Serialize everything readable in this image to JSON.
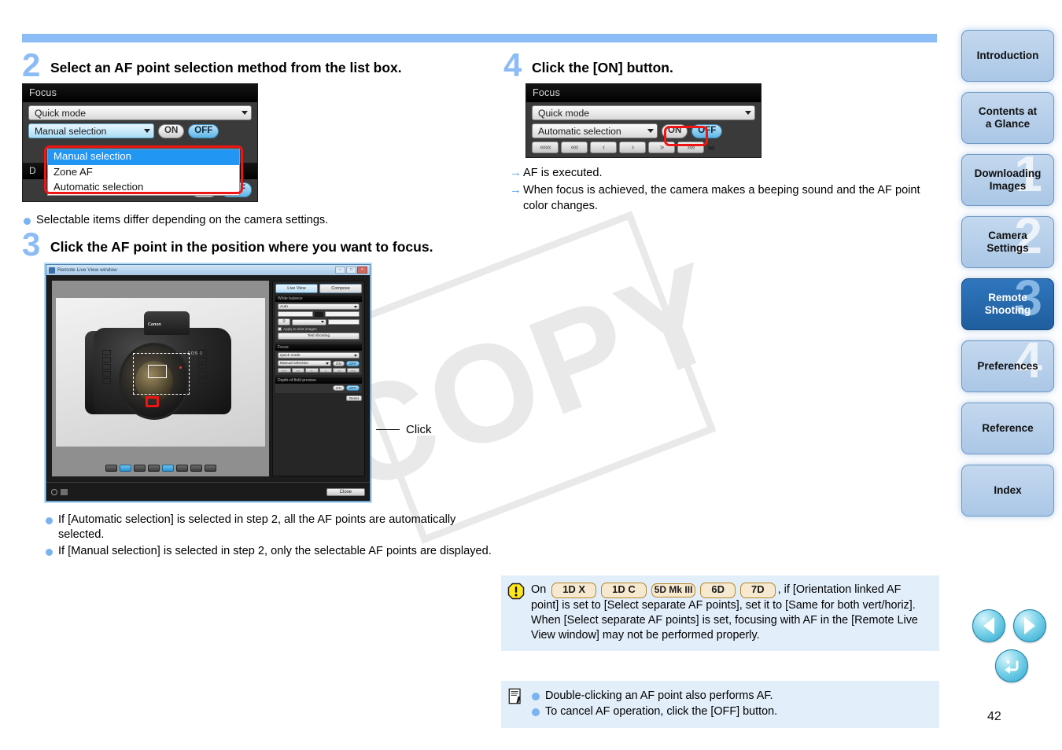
{
  "page": {
    "number": "42"
  },
  "steps": [
    {
      "num": "2",
      "title": "Select an AF point selection method from the list box.",
      "bullets": [
        "Selectable items differ depending on the camera settings."
      ]
    },
    {
      "num": "3",
      "title": "Click the AF point in the position where you want to focus.",
      "bullets": [
        "If [Automatic selection] is selected in step 2, all the AF points are automatically selected.",
        "If [Manual selection] is selected in step 2, only the selectable AF points are displayed."
      ]
    },
    {
      "num": "4",
      "title": "Click the [ON] button.",
      "arrows": [
        "AF is executed.",
        "When focus is achieved, the camera makes a beeping sound and the AF point color changes."
      ]
    }
  ],
  "focus_panel_step2": {
    "title": "Focus",
    "mode_value": "Quick mode",
    "selection_value": "Manual selection",
    "on_label": "ON",
    "off_label": "OFF",
    "dropdown_options": [
      "Manual selection",
      "Zone AF",
      "Automatic selection"
    ],
    "dropdown_selected": "Manual selection",
    "dof_title": "D",
    "dof_on_label": "ON",
    "dof_off_label": "OFF"
  },
  "focus_panel_step4": {
    "title": "Focus",
    "mode_value": "Quick mode",
    "selection_value": "Automatic selection",
    "on_label": "ON",
    "off_label": "OFF",
    "nav_buttons": [
      "«««",
      "««",
      "‹",
      "›",
      "»",
      "»»"
    ],
    "infinity_symbol": "∞"
  },
  "live_view_window": {
    "title": "Remote Live View window",
    "minimize_label": "–",
    "maximize_label": "□",
    "close_label": "×",
    "tabs": [
      "Live View",
      "Compose"
    ],
    "active_tab": "Live View",
    "white_balance": {
      "header": "White balance",
      "value": "Auto",
      "apply_label": "Apply to shot images",
      "test_shooting_label": "Test shooting"
    },
    "focus": {
      "header": "Focus",
      "mode_value": "Quick mode",
      "selection_value": "Manual selection",
      "on_label": "ON",
      "off_label": "OFF"
    },
    "dof": {
      "header": "Depth-of-field preview",
      "on_label": "ON",
      "off_label": "OFF",
      "extra_button": "Reset"
    },
    "camera_brand": "Canon",
    "camera_model": "EOS-1",
    "close_button": "Close"
  },
  "callout": {
    "label": "Click"
  },
  "notice_warning": {
    "icon": "warning-icon",
    "text_before": "On",
    "models": [
      "1D X",
      "1D C",
      "5D Mk III",
      "6D",
      "7D"
    ],
    "text_after": ", if [Orientation linked AF point] is set to [Select separate AF points], set it to [Same for both vert/horiz]. When [Select separate AF points] is set, focusing with AF in the [Remote Live View window] may not be performed properly."
  },
  "notice_note": {
    "icon": "note-icon",
    "items": [
      "Double-clicking an AF point also performs AF.",
      "To cancel AF operation, click the [OFF] button."
    ]
  },
  "sidebar": {
    "items": [
      {
        "label": "Introduction",
        "ghost": "",
        "current": false
      },
      {
        "label": "Contents at\na Glance",
        "ghost": "",
        "current": false
      },
      {
        "label": "Downloading\nImages",
        "ghost": "1",
        "current": false
      },
      {
        "label": "Camera\nSettings",
        "ghost": "2",
        "current": false
      },
      {
        "label": "Remote\nShooting",
        "ghost": "3",
        "current": true
      },
      {
        "label": "Preferences",
        "ghost": "4",
        "current": false
      },
      {
        "label": "Reference",
        "ghost": "",
        "current": false
      },
      {
        "label": "Index",
        "ghost": "",
        "current": false
      }
    ]
  },
  "page_nav": {
    "previous": "previous-page",
    "next": "next-page",
    "back": "back"
  },
  "watermark": {
    "text": "COPY"
  },
  "colors": {
    "accent_blue": "#8cbcf5",
    "notice_bg": "#e2eefa",
    "badge_bg": "#f7e9cf",
    "badge_border": "#b8862a",
    "highlight_red": "#f01414",
    "current_nav": "#2f76bd"
  }
}
